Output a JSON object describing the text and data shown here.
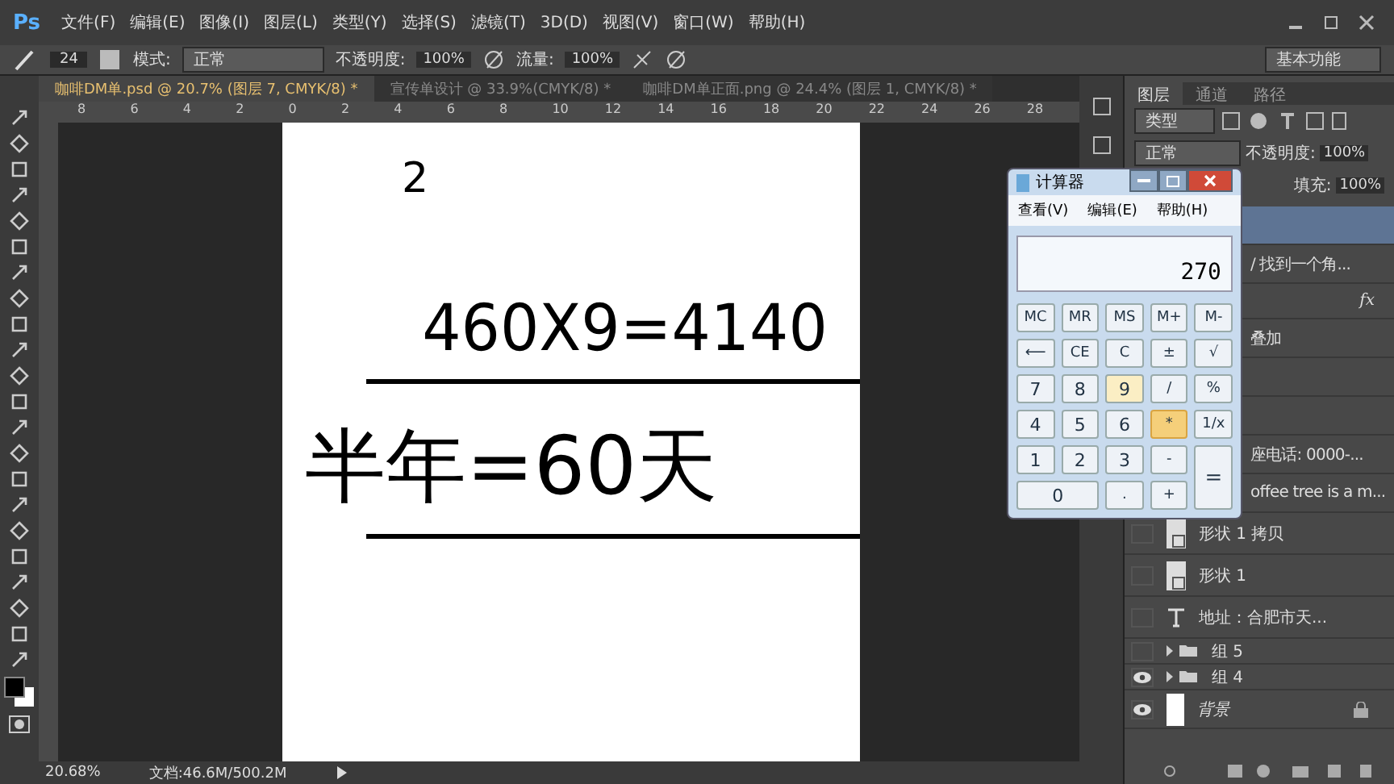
{
  "app": {
    "logo": "Ps"
  },
  "menu": [
    "文件(F)",
    "编辑(E)",
    "图像(I)",
    "图层(L)",
    "类型(Y)",
    "选择(S)",
    "滤镜(T)",
    "3D(D)",
    "视图(V)",
    "窗口(W)",
    "帮助(H)"
  ],
  "options_bar": {
    "brush_size": "24",
    "mode_label": "模式:",
    "mode_value": "正常",
    "opacity_label": "不透明度:",
    "opacity_value": "100%",
    "flow_label": "流量:",
    "flow_value": "100%",
    "workspace": "基本功能"
  },
  "tabs": [
    {
      "label": "咖啡DM单.psd @ 20.7% (图层 7, CMYK/8) *",
      "selected": true
    },
    {
      "label": "宣传单设计 @ 33.9%(CMYK/8) *",
      "selected": false
    },
    {
      "label": "咖啡DM单正面.png @ 24.4% (图层 1, CMYK/8) *",
      "selected": false
    }
  ],
  "ruler": [
    "8",
    "6",
    "4",
    "2",
    "0",
    "2",
    "4",
    "6",
    "8",
    "10",
    "12",
    "14",
    "16",
    "18",
    "20",
    "22",
    "24",
    "26",
    "28"
  ],
  "document": {
    "lines": [
      "2",
      "460X9=4140",
      "半年=60天"
    ]
  },
  "calculator": {
    "title": "计算器",
    "menu": [
      "查看(V)",
      "编辑(E)",
      "帮助(H)"
    ],
    "display": "270",
    "keys": [
      {
        "label": "MC",
        "kind": "mem",
        "hovered": false,
        "pressed": false
      },
      {
        "label": "MR",
        "kind": "mem",
        "hovered": false,
        "pressed": false
      },
      {
        "label": "MS",
        "kind": "mem",
        "hovered": false,
        "pressed": false
      },
      {
        "label": "M+",
        "kind": "mem",
        "hovered": false,
        "pressed": false
      },
      {
        "label": "M-",
        "kind": "mem",
        "hovered": false,
        "pressed": false
      },
      {
        "label": "⟵",
        "kind": "op",
        "hovered": false,
        "pressed": false
      },
      {
        "label": "CE",
        "kind": "op",
        "hovered": false,
        "pressed": false
      },
      {
        "label": "C",
        "kind": "op",
        "hovered": false,
        "pressed": false
      },
      {
        "label": "±",
        "kind": "op",
        "hovered": false,
        "pressed": false
      },
      {
        "label": "√",
        "kind": "op",
        "hovered": false,
        "pressed": false
      },
      {
        "label": "7",
        "kind": "digit",
        "hovered": false,
        "pressed": false
      },
      {
        "label": "8",
        "kind": "digit",
        "hovered": false,
        "pressed": false
      },
      {
        "label": "9",
        "kind": "digit",
        "hovered": true,
        "pressed": false
      },
      {
        "label": "/",
        "kind": "op",
        "hovered": false,
        "pressed": false
      },
      {
        "label": "%",
        "kind": "op",
        "hovered": false,
        "pressed": false
      },
      {
        "label": "4",
        "kind": "digit",
        "hovered": false,
        "pressed": false
      },
      {
        "label": "5",
        "kind": "digit",
        "hovered": false,
        "pressed": false
      },
      {
        "label": "6",
        "kind": "digit",
        "hovered": false,
        "pressed": false
      },
      {
        "label": "*",
        "kind": "op",
        "hovered": false,
        "pressed": true
      },
      {
        "label": "1/x",
        "kind": "op",
        "hovered": false,
        "pressed": false
      },
      {
        "label": "1",
        "kind": "digit",
        "hovered": false,
        "pressed": false
      },
      {
        "label": "2",
        "kind": "digit",
        "hovered": false,
        "pressed": false
      },
      {
        "label": "3",
        "kind": "digit",
        "hovered": false,
        "pressed": false
      },
      {
        "label": "-",
        "kind": "op",
        "hovered": false,
        "pressed": false
      },
      {
        "label": "=",
        "kind": "equals",
        "hovered": false,
        "pressed": false
      },
      {
        "label": "0",
        "kind": "zero",
        "hovered": false,
        "pressed": false
      },
      {
        "label": ".",
        "kind": "op",
        "hovered": false,
        "pressed": false
      },
      {
        "label": "+",
        "kind": "op",
        "hovered": false,
        "pressed": false
      }
    ]
  },
  "layers_panel": {
    "tabs": [
      {
        "label": "图层",
        "selected": true
      },
      {
        "label": "通道",
        "selected": false
      },
      {
        "label": "路径",
        "selected": false
      }
    ],
    "filter": "类型",
    "blend": "正常",
    "opacity_label": "不透明度:",
    "opacity_value": "100%",
    "fill_label": "填充:",
    "fill_value": "100%",
    "layers": [
      {
        "kind": "blank",
        "selected": true
      },
      {
        "name": "/ 找到一个角...",
        "kind": "blank",
        "selected": false
      },
      {
        "kind": "fx",
        "selected": false
      },
      {
        "name": "叠加",
        "kind": "blank",
        "selected": false
      },
      {
        "kind": "blank",
        "selected": false
      },
      {
        "kind": "blank",
        "selected": false
      },
      {
        "name": "座电话: 0000-...",
        "kind": "blank",
        "selected": false
      },
      {
        "name": "offee tree is a m...",
        "kind": "blank",
        "selected": false
      },
      {
        "name": "形状 1 拷贝",
        "kind": "shape",
        "visible": false,
        "selected": false
      },
      {
        "name": "形状 1",
        "kind": "shape",
        "visible": false,
        "selected": false
      },
      {
        "name": "地址：合肥市天...",
        "kind": "text",
        "visible": false,
        "selected": false
      },
      {
        "name": "组 5",
        "kind": "group",
        "visible": false,
        "selected": false
      },
      {
        "name": "组 4",
        "kind": "group",
        "visible": true,
        "selected": false
      },
      {
        "name": "背景",
        "kind": "background",
        "visible": true,
        "selected": false
      }
    ]
  },
  "status_bar": {
    "zoom": "20.68%",
    "doc": "文档:46.6M/500.2M"
  }
}
